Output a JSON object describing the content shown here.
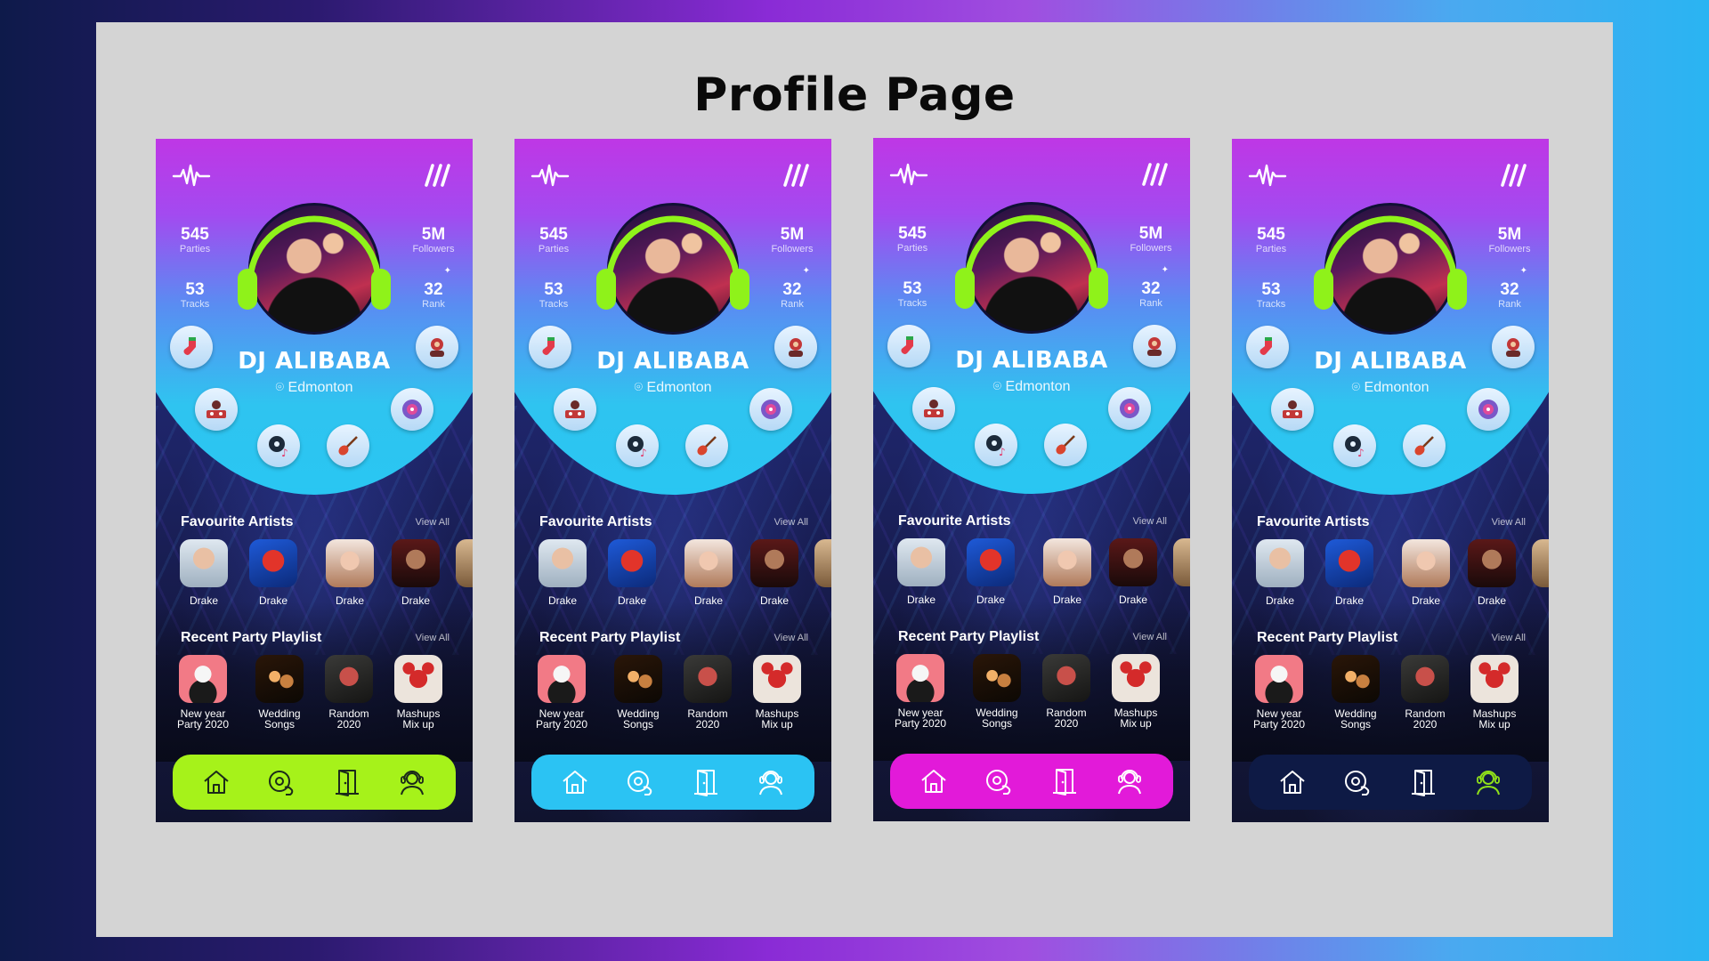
{
  "page": {
    "title": "Profile Page"
  },
  "profile": {
    "name": "DJ ALIBABA",
    "location": "Edmonton",
    "stats": {
      "parties": {
        "value": "545",
        "label": "Parties"
      },
      "tracks": {
        "value": "53",
        "label": "Tracks"
      },
      "followers": {
        "value": "5M",
        "label": "Followers"
      },
      "rank": {
        "value": "32",
        "label": "Rank"
      }
    }
  },
  "sections": {
    "favourite_artists": {
      "title": "Favourite Artists",
      "view_all": "View All"
    },
    "recent_playlist": {
      "title": "Recent Party Playlist",
      "view_all": "View All"
    }
  },
  "artists": [
    {
      "name": "Drake"
    },
    {
      "name": "Drake"
    },
    {
      "name": "Drake"
    },
    {
      "name": "Drake"
    },
    {
      "name": "D"
    }
  ],
  "playlists": [
    {
      "line1": "New year",
      "line2": "Party 2020"
    },
    {
      "line1": "Wedding",
      "line2": "Songs"
    },
    {
      "line1": "Random",
      "line2": "2020"
    },
    {
      "line1": "Mashups",
      "line2": "Mix up"
    }
  ],
  "icons": {
    "header_left": "waveform-icon",
    "header_right": "menu-slashes-icon",
    "genres": [
      "sock-icon",
      "dj-avatar-icon",
      "dj-mixer-icon",
      "vinyl-icon",
      "cd-music-icon",
      "guitar-icon"
    ],
    "nav": [
      "home-icon",
      "dj-turntable-icon",
      "door-icon",
      "dj-person-icon"
    ]
  },
  "variants": [
    {
      "nav_color": "#a6f21a",
      "nav_icon_color": "#1b2a1a",
      "active_icon_color": "#1b2a1a"
    },
    {
      "nav_color": "#2bc3f3",
      "nav_icon_color": "#ffffff",
      "active_icon_color": "#ffffff"
    },
    {
      "nav_color": "#e21ad9",
      "nav_icon_color": "#ffffff",
      "active_icon_color": "#ffffff"
    },
    {
      "nav_color": "#0e1a45",
      "nav_icon_color": "#ffffff",
      "active_icon_color": "#8fe01a"
    }
  ],
  "accent_colors": {
    "headphones": "#8ff21a",
    "disc_top": "#cc2ee0",
    "disc_bottom": "#29c6f2"
  }
}
